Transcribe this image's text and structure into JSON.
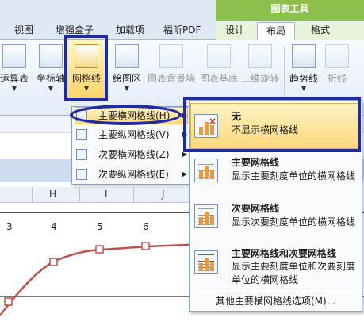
{
  "ribbon": {
    "context_title": "图表工具",
    "tabs": [
      "视图",
      "增强盒子",
      "加载项",
      "福昕PDF",
      "设计",
      "布局",
      "格式"
    ],
    "buttons": [
      "运算表",
      "坐标轴",
      "网格线",
      "绘图区",
      "图表背景墙",
      "图表基底",
      "三维旋转",
      "趋势线",
      "折线"
    ]
  },
  "sheet": {
    "columns": [
      "H",
      "I",
      "J"
    ],
    "axis_numbers": [
      "3",
      "4",
      "5",
      "6"
    ]
  },
  "menu": {
    "items": [
      "主要横网格线(H)",
      "主要纵网格线(V)",
      "次要横网格线(Z)",
      "次要纵网格线(E)"
    ]
  },
  "submenu": {
    "options": [
      {
        "title": "无",
        "desc": "不显示横网格线"
      },
      {
        "title": "主要网格线",
        "desc": "显示主要刻度单位的横网格线"
      },
      {
        "title": "次要网格线",
        "desc": "显示次要刻度单位的横网格线"
      },
      {
        "title": "主要网格线和次要网格线",
        "desc": "显示主要刻度单位和次要刻度单位的横网格线"
      }
    ],
    "more": "其他主要横网格线选项(M)..."
  },
  "colors": {
    "accent": "#1f2aa6",
    "chart_tools": "#8dc04a",
    "curve": "#c0504d"
  }
}
